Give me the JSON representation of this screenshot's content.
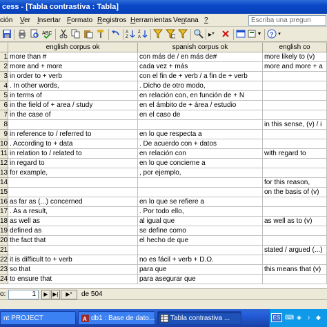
{
  "window": {
    "title": "cess - [Tabla contrastiva : Tabla]"
  },
  "menu": {
    "items": [
      {
        "label": "ción",
        "u": ""
      },
      {
        "label": "Ver",
        "u": "V"
      },
      {
        "label": "Insertar",
        "u": "I"
      },
      {
        "label": "Formato",
        "u": "F"
      },
      {
        "label": "Registros",
        "u": "R"
      },
      {
        "label": "Herramientas",
        "u": "H"
      },
      {
        "label": "Ventana",
        "u": "n"
      },
      {
        "label": "?",
        "u": "?"
      }
    ],
    "help_placeholder": "Escriba una pregun"
  },
  "columns": [
    "english corpus ok",
    "spanish corpus ok",
    "english co"
  ],
  "rows": [
    {
      "n": "1",
      "en": "more than #",
      "es": "con más de  /  en más de#",
      "en2": "more likely to  (v)"
    },
    {
      "n": "2",
      "en": "more and + more",
      "es": "cada vez + más",
      "en2": "more and more + a"
    },
    {
      "n": "3",
      "en": "in order to + verb",
      "es": "con el fin de + verb /  a fin de + verb",
      "en2": ""
    },
    {
      "n": "4",
      "en": ". In other words,",
      "es": ". Dicho de otro modo,",
      "en2": ""
    },
    {
      "n": "5",
      "en": "in terms of",
      "es": "en relación con, en función de + N",
      "en2": ""
    },
    {
      "n": "6",
      "en": "in the field of + area / study",
      "es": "en el ámbito de + área / estudio",
      "en2": ""
    },
    {
      "n": "7",
      "en": "in the case of",
      "es": "en el caso de",
      "en2": ""
    },
    {
      "n": "8",
      "en": "",
      "es": "",
      "en2": "in this sense, (v) / i"
    },
    {
      "n": "9",
      "en": "in reference to  /  referred to",
      "es": "en lo que respecta a",
      "en2": ""
    },
    {
      "n": "10",
      "en": ". According to + data",
      "es": ". De acuerdo con + datos",
      "en2": ""
    },
    {
      "n": "11",
      "en": "in relation to  /  related to",
      "es": "en relación con",
      "en2": "with regard to"
    },
    {
      "n": "12",
      "en": "in regard to",
      "es": "en lo que concierne a",
      "en2": ""
    },
    {
      "n": "13",
      "en": "for example,",
      "es": ", por ejemplo,",
      "en2": ""
    },
    {
      "n": "14",
      "en": "",
      "es": "",
      "en2": "for this reason,"
    },
    {
      "n": "15",
      "en": "",
      "es": "",
      "en2": "on the basis of (v)"
    },
    {
      "n": "16",
      "en": "as far as (...) concerned",
      "es": "en lo que se refiere a",
      "en2": ""
    },
    {
      "n": "17",
      "en": ". As a result,",
      "es": ". Por todo ello,",
      "en2": ""
    },
    {
      "n": "18",
      "en": "as well as",
      "es": "al igual que",
      "en2": "as well as to (v)"
    },
    {
      "n": "19",
      "en": "defined as",
      "es": "se define como",
      "en2": ""
    },
    {
      "n": "20",
      "en": "the fact that",
      "es": "el hecho de que",
      "en2": ""
    },
    {
      "n": "21",
      "en": "",
      "es": "",
      "en2": "stated / argued (...)"
    },
    {
      "n": "22",
      "en": "it is difficult to + verb",
      "es": "no es fácil + verb + D.O.",
      "en2": ""
    },
    {
      "n": "23",
      "en": "so that",
      "es": "para que",
      "en2": "this means that (v)"
    },
    {
      "n": "24",
      "en": "to ensure that",
      "es": "para asegurar que",
      "en2": ""
    }
  ],
  "navigator": {
    "label": "o:",
    "current": "1",
    "of_text": "de 504"
  },
  "taskbar": {
    "items": [
      {
        "label": "nt PROJECT"
      },
      {
        "label": "db1 : Base de dato..."
      },
      {
        "label": "Tabla contrastiva ..."
      }
    ],
    "tray_lang": "ES"
  },
  "colors": {
    "titlebar": "#0a47c8",
    "taskbar": "#245edb",
    "chrome": "#ece9d8"
  }
}
